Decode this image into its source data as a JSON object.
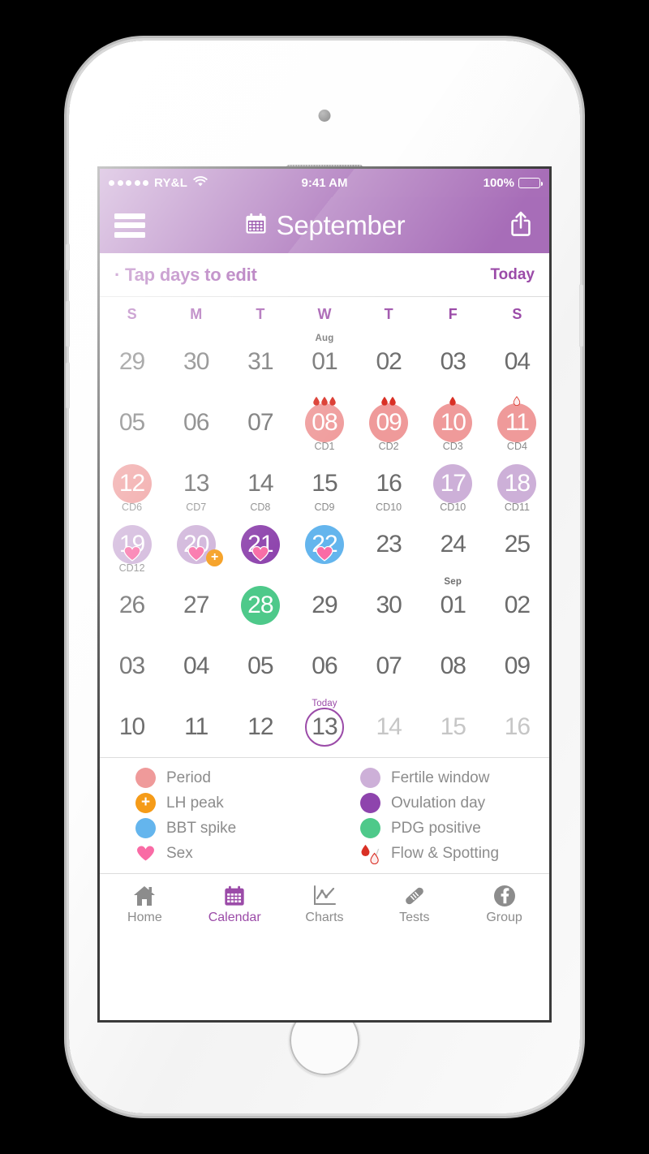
{
  "status_bar": {
    "signal_dots": 5,
    "carrier": "RY&L",
    "wifi_icon": "wifi-icon",
    "time": "9:41 AM",
    "battery_percent": "100%"
  },
  "nav_bar": {
    "menu_icon": "hamburger-menu-icon",
    "calendar_icon": "calendar-icon",
    "title": "September",
    "share_icon": "share-icon"
  },
  "sub_header": {
    "hint": "· Tap days to edit",
    "today_label": "Today"
  },
  "weekdays": [
    "S",
    "M",
    "T",
    "W",
    "T",
    "F",
    "S"
  ],
  "colors": {
    "brand_purple": "#9b59ae",
    "accent_purple": "#9b4ba8",
    "period_pink": "#ef9a9a",
    "fertile_lilac": "#cdb0d8",
    "ovulation_purple": "#8e44ad",
    "bbt_blue": "#64b5ed",
    "pdg_green": "#4ec98a",
    "lh_orange": "#f59b18",
    "sex_heart_pink": "#f96ba5",
    "flow_red": "#d93025"
  },
  "calendar": {
    "days": [
      {
        "num": "29"
      },
      {
        "num": "30"
      },
      {
        "num": "31"
      },
      {
        "num": "01",
        "month_tag": "Aug"
      },
      {
        "num": "02"
      },
      {
        "num": "03"
      },
      {
        "num": "04"
      },
      {
        "num": "05"
      },
      {
        "num": "06"
      },
      {
        "num": "07"
      },
      {
        "num": "08",
        "cd": "CD1",
        "style": "period",
        "drops": 3
      },
      {
        "num": "09",
        "cd": "CD2",
        "style": "period",
        "drops": 2
      },
      {
        "num": "10",
        "cd": "CD3",
        "style": "period",
        "drops": 1
      },
      {
        "num": "11",
        "cd": "CD4",
        "style": "period",
        "spot": 1
      },
      {
        "num": "12",
        "cd": "CD6",
        "style": "period"
      },
      {
        "num": "13",
        "cd": "CD7"
      },
      {
        "num": "14",
        "cd": "CD8"
      },
      {
        "num": "15",
        "cd": "CD9"
      },
      {
        "num": "16",
        "cd": "CD10"
      },
      {
        "num": "17",
        "cd": "CD10",
        "style": "fertile"
      },
      {
        "num": "18",
        "cd": "CD11",
        "style": "fertile"
      },
      {
        "num": "19",
        "cd": "CD12",
        "style": "fertile",
        "sex": true
      },
      {
        "num": "20",
        "style": "fertile",
        "sex": true,
        "lh": true
      },
      {
        "num": "21",
        "style": "ovulation",
        "sex": true
      },
      {
        "num": "22",
        "style": "bbt",
        "sex": true
      },
      {
        "num": "23"
      },
      {
        "num": "24"
      },
      {
        "num": "25"
      },
      {
        "num": "26"
      },
      {
        "num": "27"
      },
      {
        "num": "28",
        "style": "pdg"
      },
      {
        "num": "29"
      },
      {
        "num": "30"
      },
      {
        "num": "01",
        "month_tag": "Sep"
      },
      {
        "num": "02"
      },
      {
        "num": "03"
      },
      {
        "num": "04"
      },
      {
        "num": "05"
      },
      {
        "num": "06"
      },
      {
        "num": "07"
      },
      {
        "num": "08"
      },
      {
        "num": "09"
      },
      {
        "num": "10"
      },
      {
        "num": "11"
      },
      {
        "num": "12"
      },
      {
        "num": "13",
        "today": true,
        "today_tag": "Today"
      },
      {
        "num": "14",
        "muted": true
      },
      {
        "num": "15",
        "muted": true
      },
      {
        "num": "16",
        "muted": true
      }
    ]
  },
  "legend": [
    {
      "label": "Period",
      "icon": "period-dot-icon",
      "type": "dot",
      "color": "#ef9a9a"
    },
    {
      "label": "Fertile window",
      "icon": "fertile-dot-icon",
      "type": "dot",
      "color": "#cdb0d8"
    },
    {
      "label": "LH peak",
      "icon": "lh-peak-icon",
      "type": "plus",
      "color": "#f59b18"
    },
    {
      "label": "Ovulation day",
      "icon": "ovulation-dot-icon",
      "type": "dot",
      "color": "#8e44ad"
    },
    {
      "label": "BBT spike",
      "icon": "bbt-dot-icon",
      "type": "dot",
      "color": "#64b5ed"
    },
    {
      "label": "PDG positive",
      "icon": "pdg-dot-icon",
      "type": "dot",
      "color": "#4ec98a"
    },
    {
      "label": "Sex",
      "icon": "heart-icon",
      "type": "heart",
      "color": "#f96ba5"
    },
    {
      "label": "Flow & Spotting",
      "icon": "blood-drops-icon",
      "type": "drops",
      "color": "#d93025"
    }
  ],
  "tabs": [
    {
      "label": "Home",
      "icon": "home-icon",
      "active": false
    },
    {
      "label": "Calendar",
      "icon": "calendar-icon",
      "active": true
    },
    {
      "label": "Charts",
      "icon": "chart-icon",
      "active": false
    },
    {
      "label": "Tests",
      "icon": "test-strip-icon",
      "active": false
    },
    {
      "label": "Group",
      "icon": "facebook-icon",
      "active": false
    }
  ]
}
